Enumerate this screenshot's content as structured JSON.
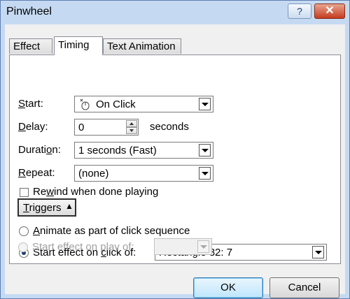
{
  "window": {
    "title": "Pinwheel",
    "help_label": "?",
    "close_label": "✕"
  },
  "tabs": [
    {
      "label": "Effect"
    },
    {
      "label": "Timing",
      "active": true
    },
    {
      "label": "Text Animation"
    }
  ],
  "timing": {
    "start": {
      "mn": "S",
      "rest": "tart:",
      "value": "On Click",
      "icon": "mouse-icon"
    },
    "delay": {
      "mn": "D",
      "rest": "elay:",
      "value": "0",
      "unit": "seconds"
    },
    "duration": {
      "pre": "Durati",
      "mn": "o",
      "rest": "n:",
      "value": "1 seconds (Fast)"
    },
    "repeat": {
      "mn": "R",
      "rest": "epeat:",
      "value": "(none)"
    },
    "rewind": {
      "pre": "Re",
      "mn": "w",
      "rest": "ind when done playing",
      "checked": false
    }
  },
  "triggers": {
    "mn": "T",
    "rest": "riggers",
    "icon": "double-chevron-up-icon"
  },
  "sequence": {
    "mn": "A",
    "rest": "nimate as part of click sequence",
    "checked": false
  },
  "click_of": {
    "pre": "Start effect on ",
    "mn": "c",
    "rest": "lick of:",
    "checked": true,
    "value": "Rectangle 82: 7"
  },
  "play_of": {
    "pre": "Start effect on ",
    "mn": "p",
    "rest": "lay of:",
    "checked": false,
    "value": ""
  },
  "buttons": {
    "ok": "OK",
    "cancel": "Cancel"
  },
  "colors": {
    "frame": "#c5daf2",
    "close": "#c43b1f",
    "default_button": "#bee6fd"
  }
}
